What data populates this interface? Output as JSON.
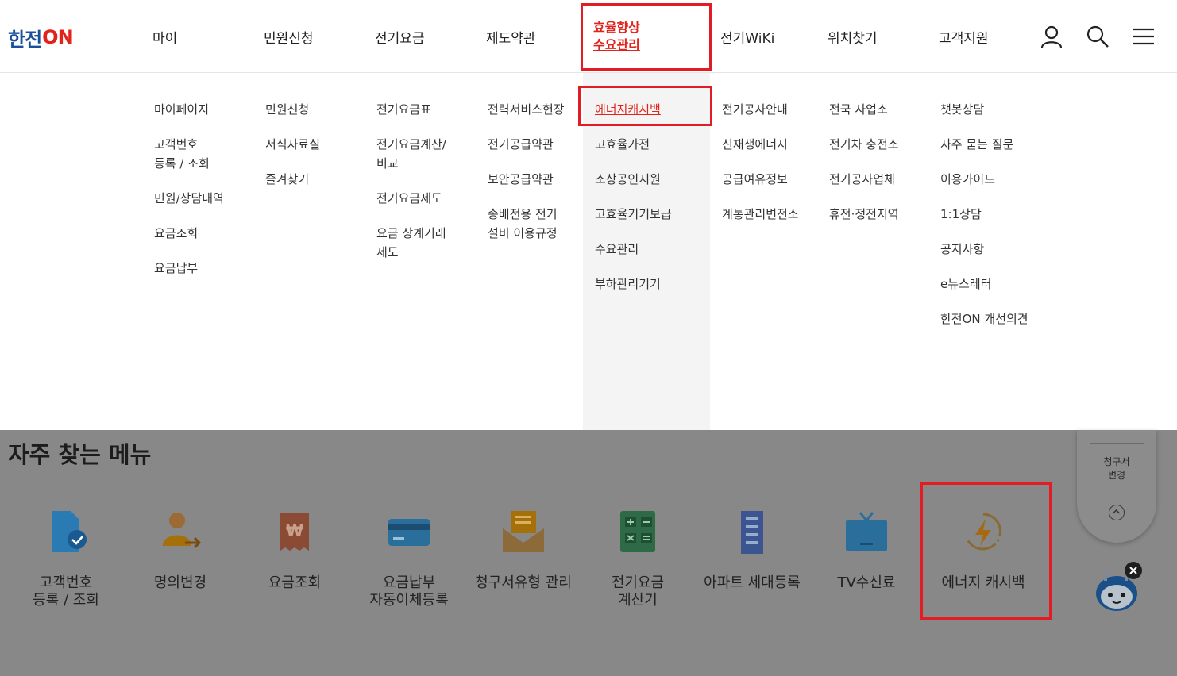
{
  "logo": {
    "part1": "한전",
    "part2": "ON"
  },
  "nav": [
    "마이",
    "민원신청",
    "전기요금",
    "제도약관",
    "효율향상\n수요관리",
    "전기WiKi",
    "위치찾기",
    "고객지원"
  ],
  "header_icons": [
    "user-icon",
    "search-icon",
    "hamburger-menu-icon"
  ],
  "menu_columns": [
    [
      "마이페이지",
      "고객번호\n등록 / 조회",
      "민원/상담내역",
      "요금조회",
      "요금납부"
    ],
    [
      "민원신청",
      "서식자료실",
      "즐겨찾기"
    ],
    [
      "전기요금표",
      "전기요금계산/\n비교",
      "전기요금제도",
      "요금 상계거래\n제도"
    ],
    [
      "전력서비스헌장",
      "전기공급약관",
      "보안공급약관",
      "송배전용 전기\n설비 이용규정"
    ],
    [
      "에너지캐시백",
      "고효율가전",
      "소상공인지원",
      "고효율기기보급",
      "수요관리",
      "부하관리기기"
    ],
    [
      "전기공사안내",
      "신재생에너지",
      "공급여유정보",
      "계통관리변전소"
    ],
    [
      "전국 사업소",
      "전기차 충전소",
      "전기공사업체",
      "휴전·정전지역"
    ],
    [
      "챗봇상담",
      "자주 묻는 질문",
      "이용가이드",
      "1:1상담",
      "공지사항",
      "e뉴스레터",
      "한전ON 개선의견"
    ]
  ],
  "section_title": "자주 찾는 메뉴",
  "quick_menu": [
    {
      "label": "고객번호\n등록 / 조회",
      "icon": "document-check-icon"
    },
    {
      "label": "명의변경",
      "icon": "user-transfer-icon"
    },
    {
      "label": "요금조회",
      "icon": "won-receipt-icon"
    },
    {
      "label": "요금납부\n자동이체등록",
      "icon": "credit-card-icon"
    },
    {
      "label": "청구서유형 관리",
      "icon": "envelope-bill-icon"
    },
    {
      "label": "전기요금\n계산기",
      "icon": "calculator-icon"
    },
    {
      "label": "아파트 세대등록",
      "icon": "apartment-icon"
    },
    {
      "label": "TV수신료",
      "icon": "tv-icon"
    },
    {
      "label": "에너지 캐시백",
      "icon": "energy-cashback-icon"
    }
  ],
  "side_widget": {
    "label": "청구서\n변경"
  },
  "colors": {
    "brand_blue": "#1a4f9c",
    "brand_red": "#e2231a",
    "highlight_box": "#e21c24"
  }
}
